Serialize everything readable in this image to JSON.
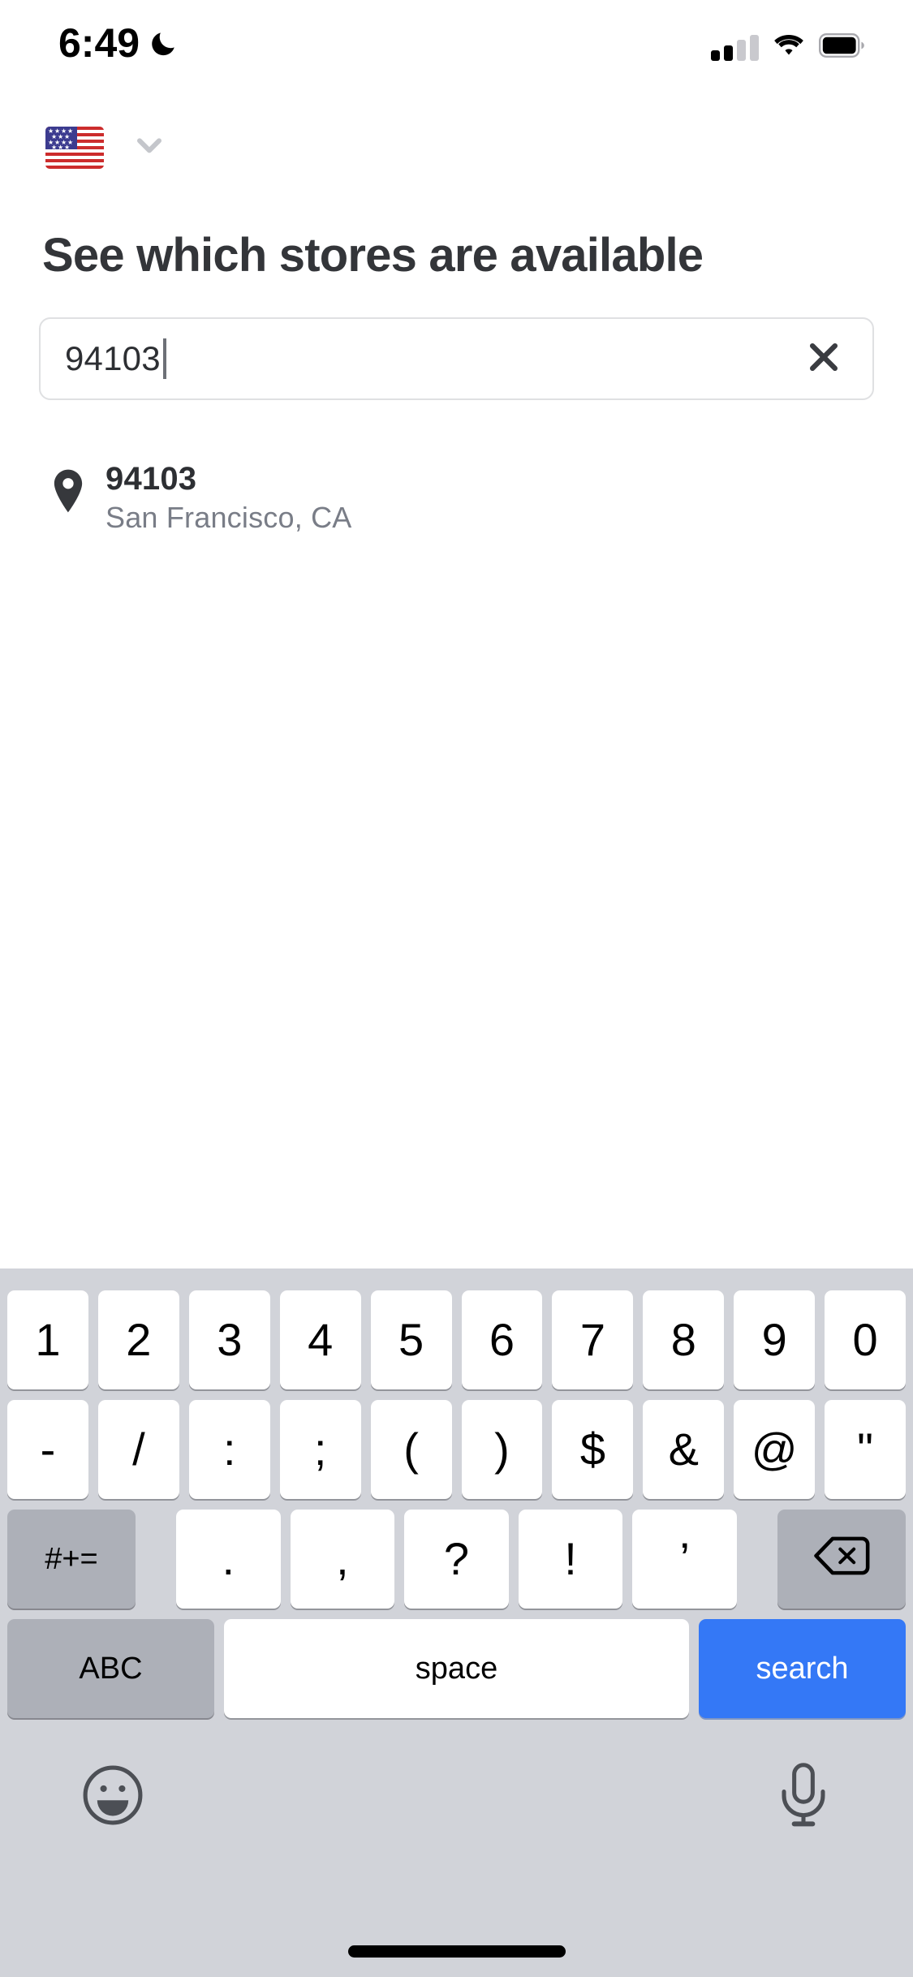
{
  "status_bar": {
    "time": "6:49",
    "dnd_icon": "moon-crescent-icon",
    "cellular_icon": "signal-bars-icon",
    "cellular_bars_filled": 2,
    "cellular_bars_total": 4,
    "wifi_icon": "wifi-icon",
    "battery_icon": "battery-full-icon"
  },
  "locale": {
    "flag": "us-flag-icon",
    "flag_label": "United States",
    "chevron": "chevron-down-icon"
  },
  "page": {
    "title": "See which stores are available"
  },
  "search": {
    "value": "94103",
    "placeholder": "",
    "clear_icon": "close-x-icon",
    "caret_visible": true
  },
  "results": [
    {
      "icon": "location-pin-icon",
      "title": "94103",
      "subtitle": "San Francisco, CA"
    }
  ],
  "keyboard": {
    "row1": [
      "1",
      "2",
      "3",
      "4",
      "5",
      "6",
      "7",
      "8",
      "9",
      "0"
    ],
    "row2": [
      "-",
      "/",
      ":",
      ";",
      "(",
      ")",
      "$",
      "&",
      "@",
      "\""
    ],
    "row3": {
      "symbols_toggle": "#+=",
      "keys": [
        ".",
        ",",
        "?",
        "!",
        "’"
      ],
      "backspace_icon": "backspace-delete-icon"
    },
    "row4": {
      "abc": "ABC",
      "space": "space",
      "search": "search"
    },
    "accessory": {
      "emoji_icon": "emoji-smiley-icon",
      "dictation_icon": "microphone-icon"
    }
  },
  "colors": {
    "accent_blue": "#3478f6",
    "keyboard_bg": "#d1d3d9",
    "key_white": "#ffffff",
    "key_gray": "#adb0b8",
    "title_gray": "#333539",
    "subtitle_gray": "#797d87",
    "border_gray": "#dfe0e2"
  },
  "system": {
    "home_indicator": "home-indicator"
  }
}
